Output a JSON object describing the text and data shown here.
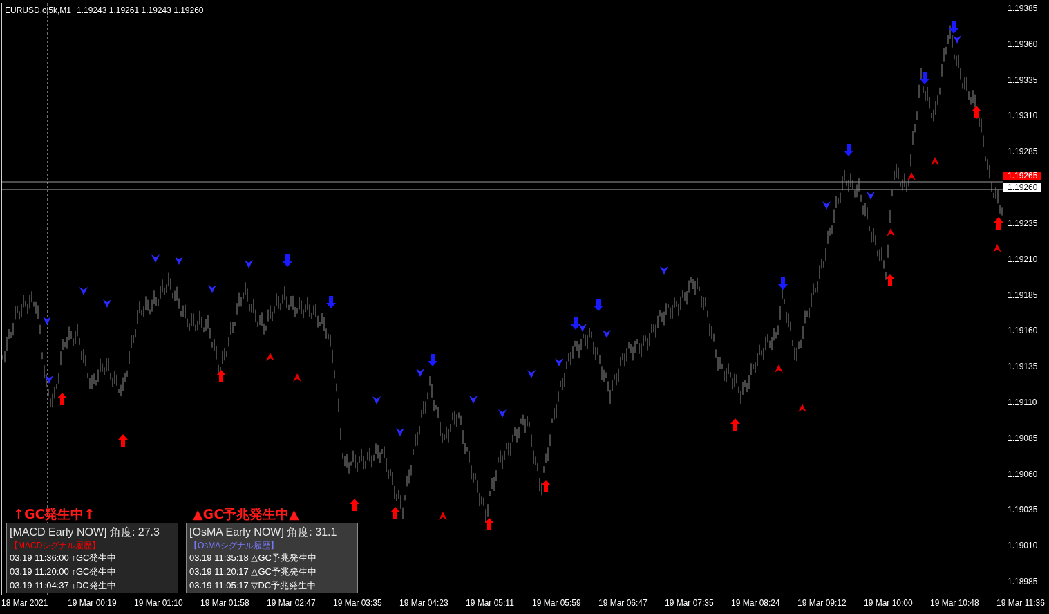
{
  "chart": {
    "symbol": "EURUSD.oj5k,M1",
    "ohlc": [
      "1.19243",
      "1.19261",
      "1.19243",
      "1.19260"
    ]
  },
  "price_axis": {
    "bid_label": "1.19265",
    "labels": [
      {
        "kind": "tick",
        "text": "1.19385"
      },
      {
        "kind": "tick",
        "text": "1.19360"
      },
      {
        "kind": "tick",
        "text": "1.19335"
      },
      {
        "kind": "tick",
        "text": "1.19310"
      },
      {
        "kind": "tick",
        "text": "1.19285"
      },
      {
        "kind": "last",
        "text": "1.19260"
      },
      {
        "kind": "tick",
        "text": "1.19235"
      },
      {
        "kind": "tick",
        "text": "1.19210"
      },
      {
        "kind": "tick",
        "text": "1.19185"
      },
      {
        "kind": "tick",
        "text": "1.19160"
      },
      {
        "kind": "tick",
        "text": "1.19135"
      },
      {
        "kind": "tick",
        "text": "1.19110"
      },
      {
        "kind": "tick",
        "text": "1.19085"
      },
      {
        "kind": "tick",
        "text": "1.19060"
      },
      {
        "kind": "tick",
        "text": "1.19035"
      },
      {
        "kind": "tick",
        "text": "1.19010"
      },
      {
        "kind": "tick",
        "text": "1.18985"
      }
    ]
  },
  "time_axis": {
    "ticks": [
      "18 Mar 2021",
      "19 Mar 00:19",
      "19 Mar 01:10",
      "19 Mar 01:58",
      "19 Mar 02:47",
      "19 Mar 03:35",
      "19 Mar 04:23",
      "19 Mar 05:11",
      "19 Mar 05:59",
      "19 Mar 06:47",
      "19 Mar 07:35",
      "19 Mar 08:24",
      "19 Mar 09:12",
      "19 Mar 10:00",
      "19 Mar 10:48",
      "19 Mar 11:36"
    ]
  },
  "panels": [
    {
      "kind": "macd",
      "headline": "↑GC発生中↑",
      "title": "[MACD Early NOW] 角度: 27.3",
      "history_title": "【MACDシグナル履歴】",
      "color": "#ff0000",
      "history": [
        "03.19 11:36:00 ↑GC発生中",
        "03.19 11:20:00 ↑GC発生中",
        "03.19 11:04:37 ↓DC発生中"
      ]
    },
    {
      "kind": "osma",
      "headline": "▲GC予兆発生中▲",
      "title": "[OsMA Early NOW] 角度: 31.1",
      "history_title": "【OsMAシグナル履歴】",
      "color": "#7a7aff",
      "history": [
        "03.19 11:35:18 △GC予兆発生中",
        "03.19 11:20:17 △GC予兆発生中",
        "03.19 11:05:17 ▽DC予兆発生中"
      ]
    }
  ]
}
